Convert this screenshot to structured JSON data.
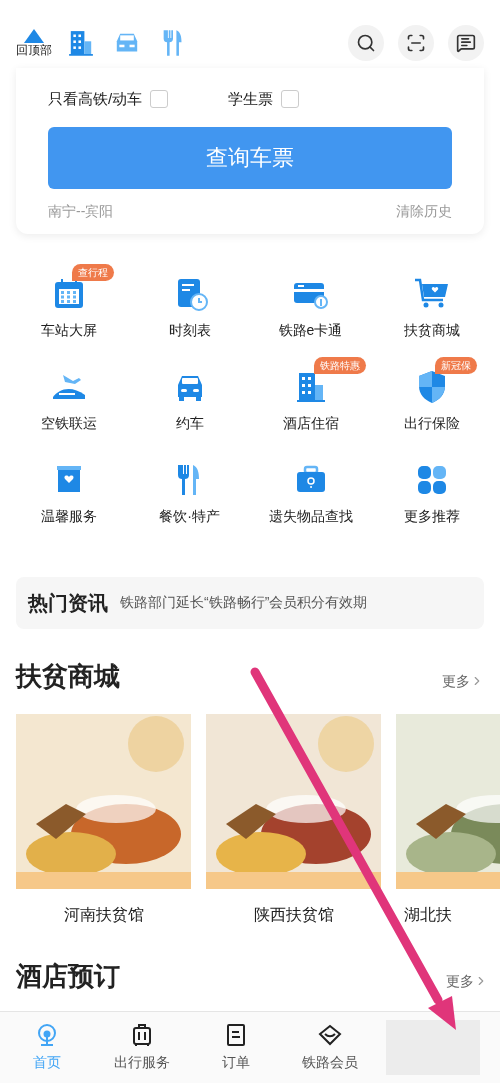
{
  "header": {
    "back_to_top": "回顶部"
  },
  "search_card": {
    "options": [
      {
        "label": "只看高铁/动车",
        "checked": false
      },
      {
        "label": "学生票",
        "checked": false
      }
    ],
    "button": "查询车票",
    "history": "南宁--宾阳",
    "clear": "清除历史"
  },
  "services": [
    {
      "label": "车站大屏",
      "badge": "查行程"
    },
    {
      "label": "时刻表"
    },
    {
      "label": "铁路e卡通"
    },
    {
      "label": "扶贫商城"
    },
    {
      "label": "空铁联运"
    },
    {
      "label": "约车"
    },
    {
      "label": "酒店住宿",
      "badge": "铁路特惠"
    },
    {
      "label": "出行保险",
      "badge": "新冠保"
    },
    {
      "label": "温馨服务"
    },
    {
      "label": "餐饮·特产"
    },
    {
      "label": "遗失物品查找"
    },
    {
      "label": "更多推荐"
    }
  ],
  "news": {
    "title": "热门资讯",
    "text": "铁路部门延长“铁路畅行”会员积分有效期"
  },
  "mall": {
    "title": "扶贫商城",
    "more": "更多",
    "items": [
      {
        "caption": "河南扶贫馆",
        "kind": "picture"
      },
      {
        "caption": "陕西扶贫馆",
        "kind": "picture"
      },
      {
        "caption": "湖北扶",
        "kind": "picture"
      }
    ]
  },
  "hotel": {
    "title": "酒店预订",
    "more": "更多"
  },
  "tabs": [
    {
      "label": "首页",
      "selected": true
    },
    {
      "label": "出行服务",
      "selected": false
    },
    {
      "label": "订单",
      "selected": false
    },
    {
      "label": "铁路会员",
      "selected": false
    },
    {
      "kind": "blurred",
      "selected": false
    }
  ]
}
